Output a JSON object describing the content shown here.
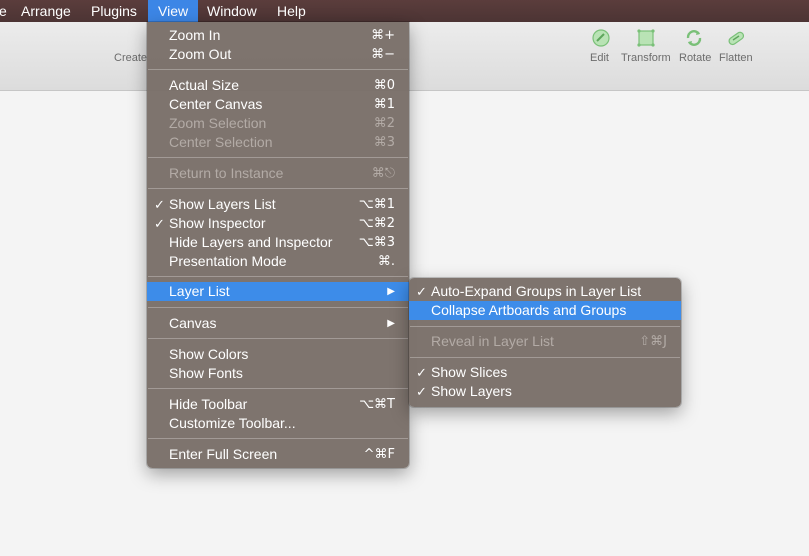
{
  "menubar": {
    "items": [
      {
        "label": "e"
      },
      {
        "label": "Arrange"
      },
      {
        "label": "Plugins"
      },
      {
        "label": "View"
      },
      {
        "label": "Window"
      },
      {
        "label": "Help"
      }
    ]
  },
  "toolbar": {
    "create_label": "Create",
    "tools": [
      {
        "label": "Edit",
        "icon": "edit-icon"
      },
      {
        "label": "Transform",
        "icon": "transform-icon"
      },
      {
        "label": "Rotate",
        "icon": "rotate-icon"
      },
      {
        "label": "Flatten",
        "icon": "flatten-icon"
      }
    ]
  },
  "view_menu": {
    "zoom_in": {
      "label": "Zoom In",
      "shortcut": "⌘+"
    },
    "zoom_out": {
      "label": "Zoom Out",
      "shortcut": "⌘−"
    },
    "actual_size": {
      "label": "Actual Size",
      "shortcut": "⌘0"
    },
    "center_canvas": {
      "label": "Center Canvas",
      "shortcut": "⌘1"
    },
    "zoom_selection": {
      "label": "Zoom Selection",
      "shortcut": "⌘2"
    },
    "center_selection": {
      "label": "Center Selection",
      "shortcut": "⌘3"
    },
    "return_to_instance": {
      "label": "Return to Instance",
      "shortcut": "⌘⎋"
    },
    "show_layers_list": {
      "label": "Show Layers List",
      "shortcut": "⌥⌘1",
      "checked": "✓"
    },
    "show_inspector": {
      "label": "Show Inspector",
      "shortcut": "⌥⌘2",
      "checked": "✓"
    },
    "hide_layers_inspector": {
      "label": "Hide Layers and Inspector",
      "shortcut": "⌥⌘3"
    },
    "presentation_mode": {
      "label": "Presentation Mode",
      "shortcut": "⌘."
    },
    "layer_list": {
      "label": "Layer List",
      "arrow": "▶"
    },
    "canvas": {
      "label": "Canvas",
      "arrow": "▶"
    },
    "show_colors": {
      "label": "Show Colors"
    },
    "show_fonts": {
      "label": "Show Fonts"
    },
    "hide_toolbar": {
      "label": "Hide Toolbar",
      "shortcut": "⌥⌘T"
    },
    "customize_toolbar": {
      "label": "Customize Toolbar..."
    },
    "enter_full_screen": {
      "label": "Enter Full Screen",
      "shortcut": "^⌘F"
    }
  },
  "layer_list_submenu": {
    "auto_expand": {
      "label": "Auto-Expand Groups in Layer List",
      "checked": "✓"
    },
    "collapse": {
      "label": "Collapse Artboards and Groups"
    },
    "reveal": {
      "label": "Reveal in Layer List",
      "shortcut": "⇧⌘J"
    },
    "show_slices": {
      "label": "Show Slices",
      "checked": "✓"
    },
    "show_layers": {
      "label": "Show Layers",
      "checked": "✓"
    }
  },
  "colors": {
    "menubar_bg": "#503636",
    "highlight": "#3d8ce9",
    "menu_bg": "#7a7069",
    "tool_icon": "#8fcf8f"
  }
}
